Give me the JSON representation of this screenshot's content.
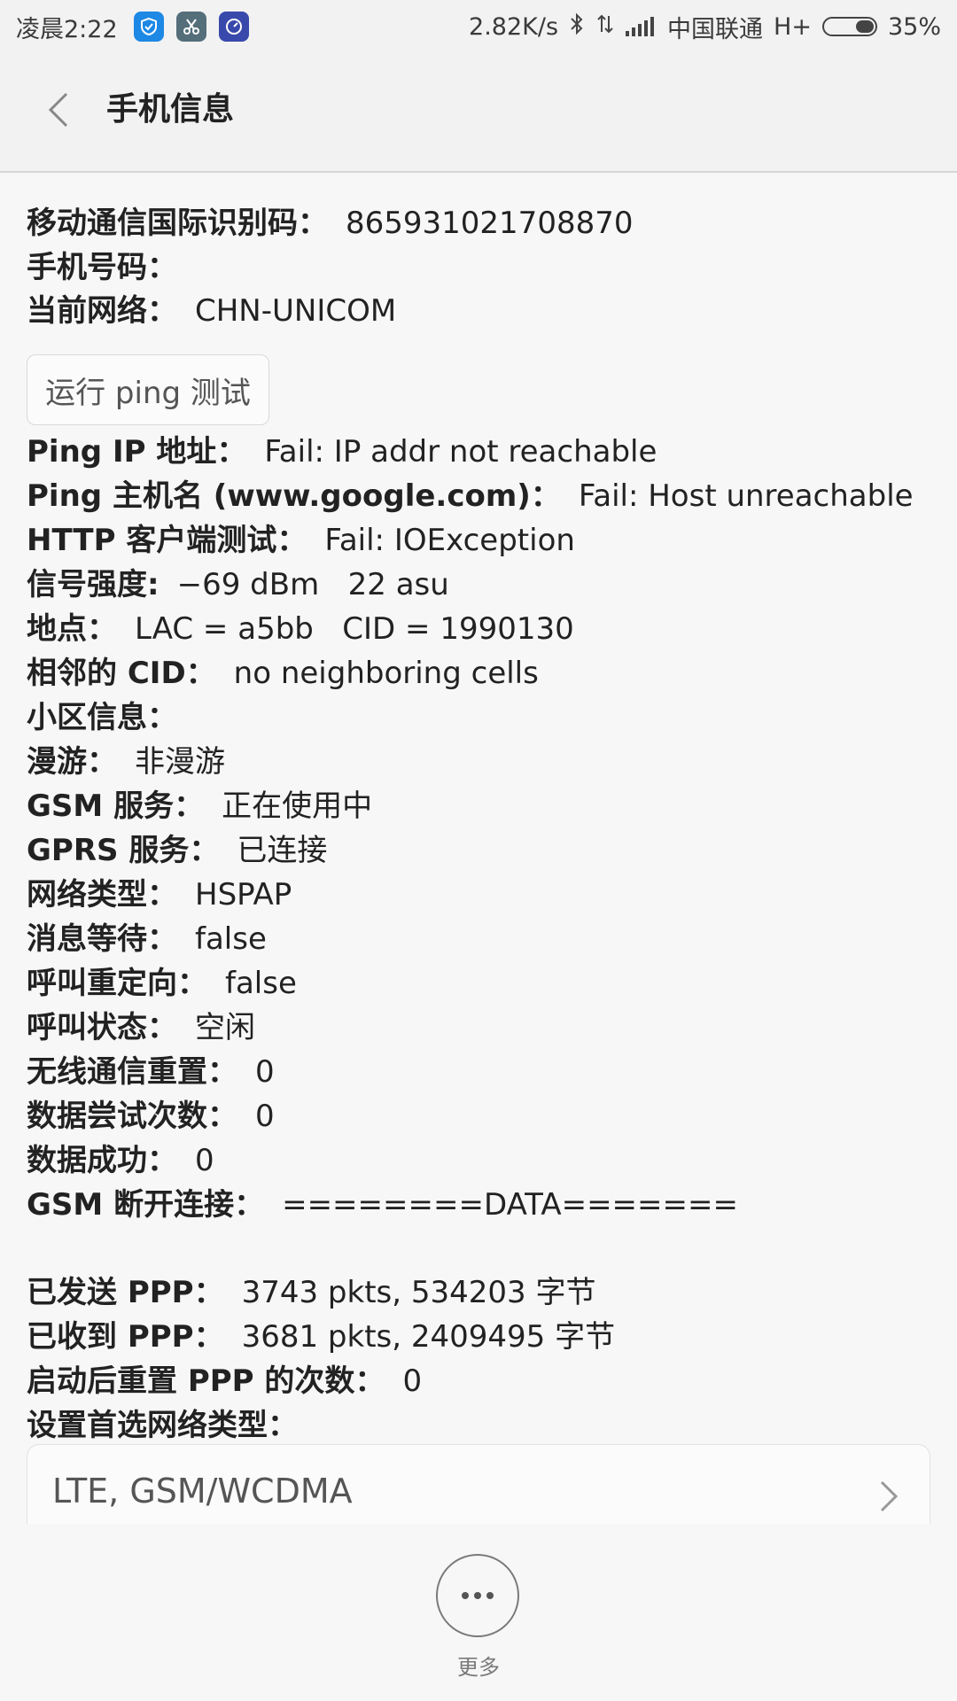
{
  "status_bar": {
    "time": "凌晨2:22",
    "speed": "2.82K/s",
    "carrier": "中国联通",
    "network_type": "H+",
    "battery": "35%",
    "battery_level": 0.35,
    "icons": [
      "shield-app-icon",
      "scissors-app-icon",
      "gauge-app-icon",
      "bluetooth-icon",
      "data-arrows-icon",
      "signal-icon",
      "battery-icon"
    ]
  },
  "header": {
    "title": "手机信息"
  },
  "info": {
    "imei": {
      "label": "移动通信国际识别码：",
      "value": "865931021708870"
    },
    "phone_number": {
      "label": "手机号码：",
      "value": ""
    },
    "current_network": {
      "label": "当前网络：",
      "value": "CHN-UNICOM"
    },
    "ping_button": "运行 ping 测试",
    "ping_ip": {
      "label": "Ping IP 地址：",
      "value": "Fail: IP addr not reachable"
    },
    "ping_host": {
      "label": "Ping 主机名 (www.google.com)：",
      "value": "Fail: Host unreachable"
    },
    "http_test": {
      "label": "HTTP 客户端测试：",
      "value": "Fail: IOException"
    },
    "signal": {
      "label": "信号强度:",
      "value": "−69 dBm   22 asu"
    },
    "location": {
      "label": "地点：",
      "value": "LAC = a5bb   CID = 1990130"
    },
    "neighbor_cid": {
      "label": "相邻的 CID：",
      "value": "no neighboring cells"
    },
    "cell_info": {
      "label": "小区信息：",
      "value": ""
    },
    "roaming": {
      "label": "漫游：",
      "value": "非漫游"
    },
    "gsm_service": {
      "label": "GSM 服务：",
      "value": "正在使用中"
    },
    "gprs_service": {
      "label": "GPRS 服务：",
      "value": "已连接"
    },
    "network_kind": {
      "label": "网络类型：",
      "value": "HSPAP"
    },
    "message_waiting": {
      "label": "消息等待：",
      "value": "false"
    },
    "call_redirect": {
      "label": "呼叫重定向：",
      "value": "false"
    },
    "call_state": {
      "label": "呼叫状态：",
      "value": "空闲"
    },
    "radio_resets": {
      "label": "无线通信重置：",
      "value": "0"
    },
    "data_attempts": {
      "label": "数据尝试次数：",
      "value": "0"
    },
    "data_success": {
      "label": "数据成功：",
      "value": "0"
    },
    "gsm_disconnect": {
      "label": "GSM 断开连接：",
      "value": "========DATA======="
    },
    "ppp_sent": {
      "label": "已发送 PPP：",
      "value": "3743 pkts, 534203 字节"
    },
    "ppp_received": {
      "label": "已收到 PPP：",
      "value": "3681 pkts, 2409495 字节"
    },
    "ppp_resets": {
      "label": "启动后重置 PPP 的次数：",
      "value": "0"
    },
    "preferred_network": {
      "label": "设置首选网络类型：",
      "value": "LTE, GSM/WCDMA"
    }
  },
  "bottom": {
    "more_label": "更多"
  }
}
